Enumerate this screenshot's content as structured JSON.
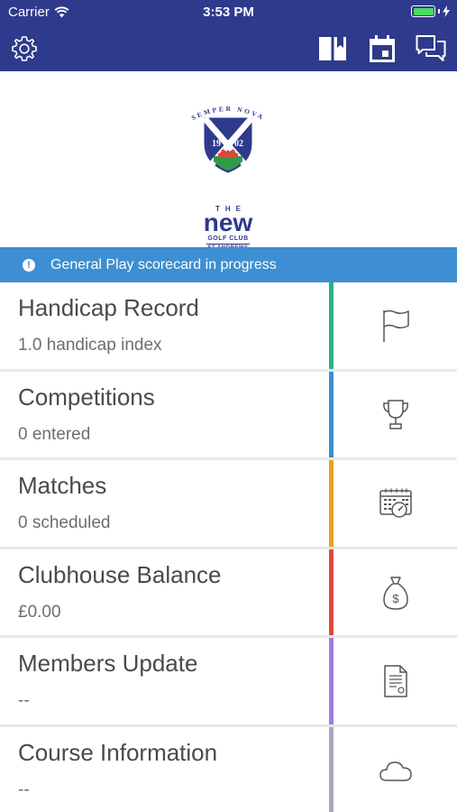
{
  "status_bar": {
    "carrier": "Carrier",
    "time": "3:53 PM"
  },
  "nav": {
    "left_icon": "gear-icon",
    "right_icons": [
      "book-icon",
      "calendar-icon",
      "chat-icon"
    ]
  },
  "logo": {
    "motto": "SEMPER NOVA",
    "year_left": "19",
    "year_right": "02",
    "the": "THE",
    "name": "new",
    "golf_club": "GOLF CLUB",
    "location": "ST ANDREWS"
  },
  "banner": {
    "text": "General Play scorecard in progress",
    "icon": "alert-icon"
  },
  "menu": {
    "items": [
      {
        "title": "Handicap Record",
        "subtitle": "1.0 handicap index",
        "accent": "#2bb38a",
        "icon": "flag-icon"
      },
      {
        "title": "Competitions",
        "subtitle": "0 entered",
        "accent": "#3d8fd1",
        "icon": "trophy-icon"
      },
      {
        "title": "Matches",
        "subtitle": "0 scheduled",
        "accent": "#e8a21c",
        "icon": "calendar-clock-icon"
      },
      {
        "title": "Clubhouse Balance",
        "subtitle": "£0.00",
        "accent": "#e0473a",
        "icon": "money-bag-icon"
      },
      {
        "title": "Members Update",
        "subtitle": "--",
        "accent": "#9b7fe0",
        "icon": "document-icon"
      },
      {
        "title": "Course Information",
        "subtitle": "--",
        "accent": "#a7a9b5",
        "icon": "cloud-icon"
      }
    ]
  },
  "colors": {
    "primary": "#2e3a8c",
    "banner": "#3d8fd1",
    "battery": "#4cd964"
  }
}
